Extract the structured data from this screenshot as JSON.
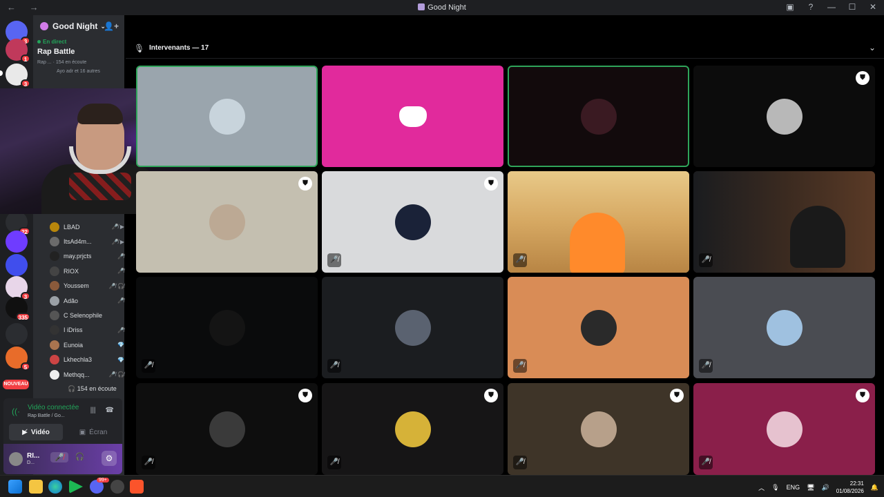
{
  "window": {
    "title": "Good Night",
    "nav_arrows": "← →"
  },
  "guilds": [
    {
      "name": "Discord Home",
      "badge": "3",
      "color": "#5865f2"
    },
    {
      "name": "Server 1",
      "badge": "1",
      "color": "#c0395b"
    },
    {
      "name": "Server 2",
      "badge": "3",
      "color": "#e9e9e9"
    },
    {
      "name": "Server 3",
      "badge": "22",
      "color": "#2b2d31"
    },
    {
      "name": "HL",
      "badge": "",
      "color": "#6f3cff"
    },
    {
      "name": "Folder",
      "badge": "",
      "color": "#404eed"
    },
    {
      "name": "Server 4",
      "badge": "3",
      "color": "#e8d6e9"
    },
    {
      "name": "Server 5",
      "badge": "335",
      "color": "#101010"
    },
    {
      "name": "Server 6",
      "badge": "",
      "color": "#2b2d31"
    },
    {
      "name": "Server 7",
      "badge": "5",
      "color": "#e86c2a"
    },
    {
      "name": "NOUVEAU",
      "badge": "NOUVEAU",
      "color": "#f23f43"
    }
  ],
  "server": {
    "name": "Good Night",
    "live_label": "En direct",
    "stage_name": "Rap Battle",
    "meta_text": "Rap ... · 154 en écoute",
    "speakers_text": "Ayo adr et 16 autres"
  },
  "members": [
    {
      "name": "LBAD",
      "icons": "🎤̸ ▶",
      "color": "#b8860b"
    },
    {
      "name": "ItsAd4m...",
      "icons": "🎤̸ ▶",
      "color": "#6b6b6b"
    },
    {
      "name": "may.prjcts",
      "icons": "🎤̸",
      "color": "#222"
    },
    {
      "name": "RIOX",
      "icons": "🎤̸",
      "color": "#444"
    },
    {
      "name": "Youssem",
      "icons": "🎤̸ 🎧̸",
      "color": "#8a5a3b"
    },
    {
      "name": "Adão",
      "icons": "🎤̸",
      "color": "#9aa0a6"
    },
    {
      "name": "C Selenophile",
      "icons": "",
      "color": "#555"
    },
    {
      "name": "I iDriss",
      "icons": "🎤̸",
      "color": "#333"
    },
    {
      "name": "Eunoia",
      "icons": "💎",
      "color": "#a9744f"
    },
    {
      "name": "Lkhechla3",
      "icons": "💎",
      "color": "#c44"
    },
    {
      "name": "Methqq...",
      "icons": "🎤̸ 🎧̸",
      "color": "#eee"
    }
  ],
  "listeners": "154 en écoute",
  "voice": {
    "connected": "Vidéo connectée",
    "channel": "Rap Battle / Go...",
    "video_label": "Vidéo",
    "screen_label": "Écran"
  },
  "user": {
    "name": "RI...",
    "status": "D..."
  },
  "stage": {
    "section_label": "Intervenants — 17"
  },
  "tiles": [
    {
      "bg": "#9aa5ad",
      "avatar": "#c8d4dc",
      "speaking": true,
      "mod": false,
      "muted": false
    },
    {
      "bg": "#e12a9c",
      "avatar": "discord",
      "speaking": false,
      "mod": false,
      "muted": false
    },
    {
      "bg": "#120a0c",
      "avatar": "#3a1a22",
      "speaking": true,
      "mod": false,
      "muted": false
    },
    {
      "bg": "#0c0c0c",
      "avatar": "#b8b8b8",
      "speaking": false,
      "mod": true,
      "muted": false
    },
    {
      "bg": "#c4bfb0",
      "avatar": "#bca994",
      "speaking": false,
      "mod": true,
      "muted": false
    },
    {
      "bg": "#d9dadc",
      "avatar": "#1a2238",
      "speaking": false,
      "mod": true,
      "muted": true
    },
    {
      "bg": "#d8b46a",
      "avatar": "video",
      "speaking": false,
      "mod": false,
      "muted": true
    },
    {
      "bg": "#3a2a22",
      "avatar": "video2",
      "speaking": false,
      "mod": false,
      "muted": true
    },
    {
      "bg": "#0a0b0c",
      "avatar": "#141414",
      "speaking": false,
      "mod": false,
      "muted": true
    },
    {
      "bg": "#1b1d20",
      "avatar": "#5a6270",
      "speaking": false,
      "mod": false,
      "muted": true
    },
    {
      "bg": "#d98c56",
      "avatar": "#2a2a2a",
      "speaking": false,
      "mod": false,
      "muted": true
    },
    {
      "bg": "#4a4c52",
      "avatar": "#9fc1e0",
      "speaking": false,
      "mod": false,
      "muted": true
    },
    {
      "bg": "#0e0e0e",
      "avatar": "#3a3a3a",
      "speaking": false,
      "mod": true,
      "muted": true
    },
    {
      "bg": "#161516",
      "avatar": "#d6b238",
      "speaking": false,
      "mod": true,
      "muted": true
    },
    {
      "bg": "#3e3428",
      "avatar": "#b7a08a",
      "speaking": false,
      "mod": true,
      "muted": true
    },
    {
      "bg": "#8a1f4a",
      "avatar": "#e6c2cf",
      "speaking": false,
      "mod": true,
      "muted": true
    }
  ],
  "taskbar": {
    "lang": "ENG",
    "time": "22:31",
    "date": "01/08/2026",
    "discord_badge": "99+"
  }
}
